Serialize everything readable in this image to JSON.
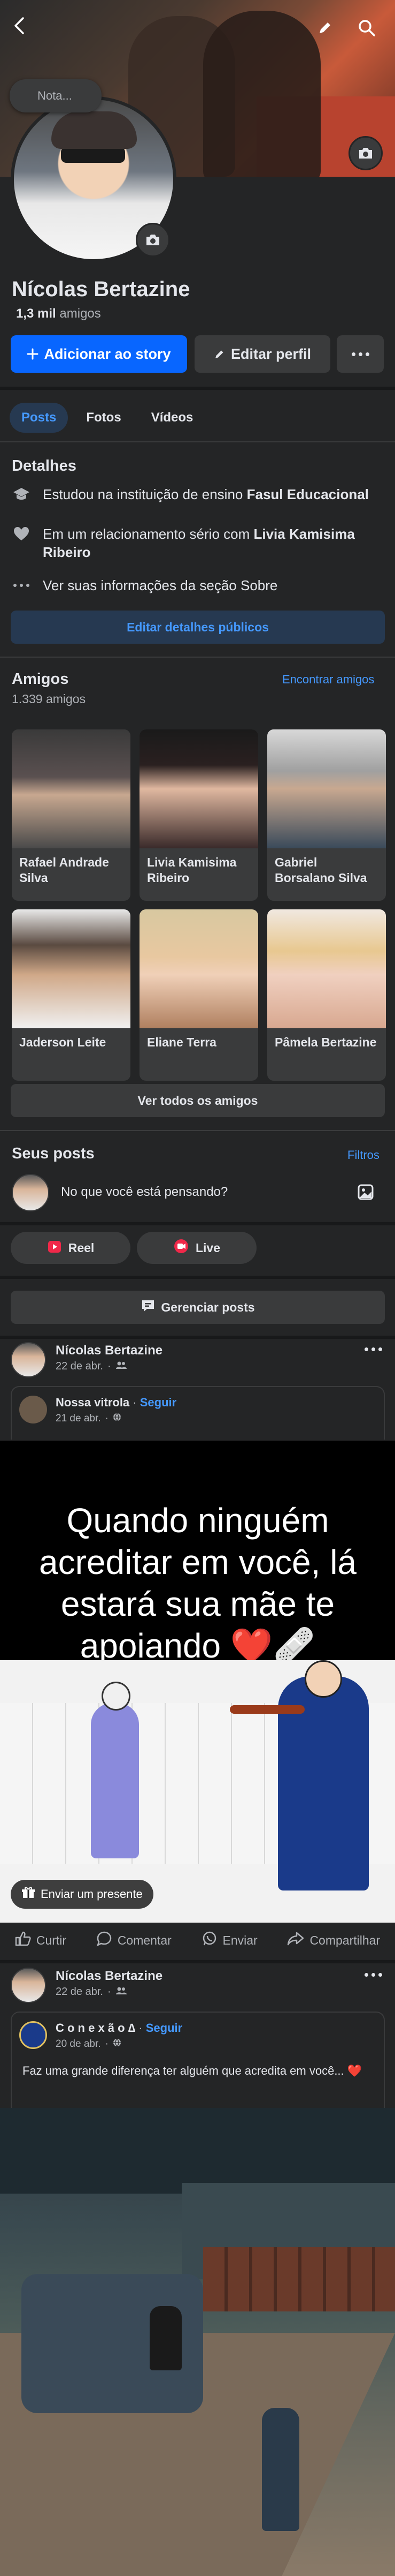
{
  "profile": {
    "note_placeholder": "Nota...",
    "name": "Nícolas Bertazine",
    "friends_count": "1,3 mil",
    "friends_suffix": "amigos"
  },
  "actions": {
    "add_story": "Adicionar ao story",
    "edit_profile": "Editar perfil",
    "more": "···"
  },
  "tabs": [
    {
      "label": "Posts",
      "active": true
    },
    {
      "label": "Fotos",
      "active": false
    },
    {
      "label": "Vídeos",
      "active": false
    }
  ],
  "details": {
    "title": "Detalhes",
    "study_prefix": "Estudou na instituição de ensino ",
    "study_place": "Fasul Educacional",
    "relationship_prefix": "Em um relacionamento sério com ",
    "relationship_partner": "Livia Kamisima Ribeiro",
    "see_more": "Ver suas informações da seção Sobre",
    "edit_public": "Editar detalhes públicos"
  },
  "friends": {
    "title": "Amigos",
    "count": "1.339 amigos",
    "find": "Encontrar amigos",
    "see_all": "Ver todos os amigos",
    "list": [
      {
        "name": "Rafael Andrade Silva",
        "photo": "#4a4a4a"
      },
      {
        "name": "Livia Kamisima Ribeiro",
        "photo": "#5a3a30"
      },
      {
        "name": "Gabriel Borsalano Silva",
        "photo": "#8a8a8a"
      },
      {
        "name": "Jaderson Leite",
        "photo": "#6a5a50"
      },
      {
        "name": "Eliane Terra",
        "photo": "#d8c0a8"
      },
      {
        "name": "Pâmela Bertazine",
        "photo": "#c8b090"
      }
    ]
  },
  "composer": {
    "title": "Seus posts",
    "filters": "Filtros",
    "placeholder": "No que você está pensando?",
    "reel": "Reel",
    "live": "Live",
    "manage": "Gerenciar posts"
  },
  "post1": {
    "author": "Nícolas Bertazine",
    "date": "22 de abr.",
    "shared_page": "Nossa vitrola",
    "follow": "Seguir",
    "shared_date": "21 de abr.",
    "image_text": "Quando ninguém acreditar em você, lá estará sua mãe te apoiando ❤️🩹",
    "send_gift": "Enviar um presente"
  },
  "post_actions": {
    "like": "Curtir",
    "comment": "Comentar",
    "send": "Enviar",
    "share": "Compartilhar"
  },
  "post2": {
    "author": "Nícolas Bertazine",
    "date": "22 de abr.",
    "shared_page": "C o n e x ã o ∆",
    "follow": "Seguir",
    "shared_date": "20 de abr.",
    "text": "Faz uma grande diferença ter alguém que acredita em você... ❤️"
  },
  "colors": {
    "background": "#242526",
    "surface": "#3a3b3c",
    "accent": "#0866ff",
    "link": "#4599ff",
    "live_red": "#f02849"
  }
}
